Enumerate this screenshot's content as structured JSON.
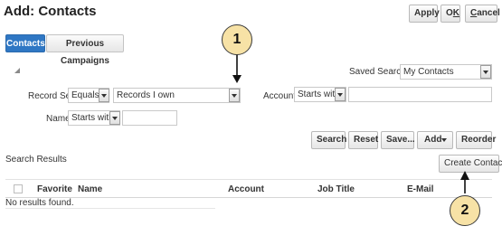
{
  "page": {
    "title": "Add: Contacts"
  },
  "header_buttons": {
    "apply": "Apply",
    "ok_prefix": "O",
    "ok_underlined": "K",
    "cancel_underlined": "C",
    "cancel_rest": "ancel"
  },
  "tabs": [
    {
      "label": "Contacts",
      "active": true
    },
    {
      "label": "Previous Campaigns",
      "active": false
    }
  ],
  "search": {
    "saved_search_label": "Saved Search",
    "saved_search_value": "My Contacts",
    "record_set_label": "Record Set",
    "record_set_operator": "Equals",
    "record_set_value": "Records I own",
    "account_label": "Account",
    "account_operator": "Starts with",
    "account_value": "",
    "name_label": "Name",
    "name_operator": "Starts with",
    "name_value": ""
  },
  "actions": {
    "search": "Search",
    "reset": "Reset",
    "save": "Save...",
    "add": "Add",
    "reorder": "Reorder"
  },
  "results": {
    "section_label": "Search Results",
    "create_button": "Create Contact",
    "columns": [
      "Favorite",
      "Name",
      "Account",
      "Job Title",
      "E-Mail"
    ],
    "empty_message": "No results found."
  },
  "callouts": [
    {
      "number": "1"
    },
    {
      "number": "2"
    }
  ],
  "colors": {
    "active_tab": "#2f77c4",
    "callout_fill": "#f7e2a6"
  },
  "icons": {
    "dropdown": "chevron-down-icon",
    "collapse": "triangle-icon"
  }
}
